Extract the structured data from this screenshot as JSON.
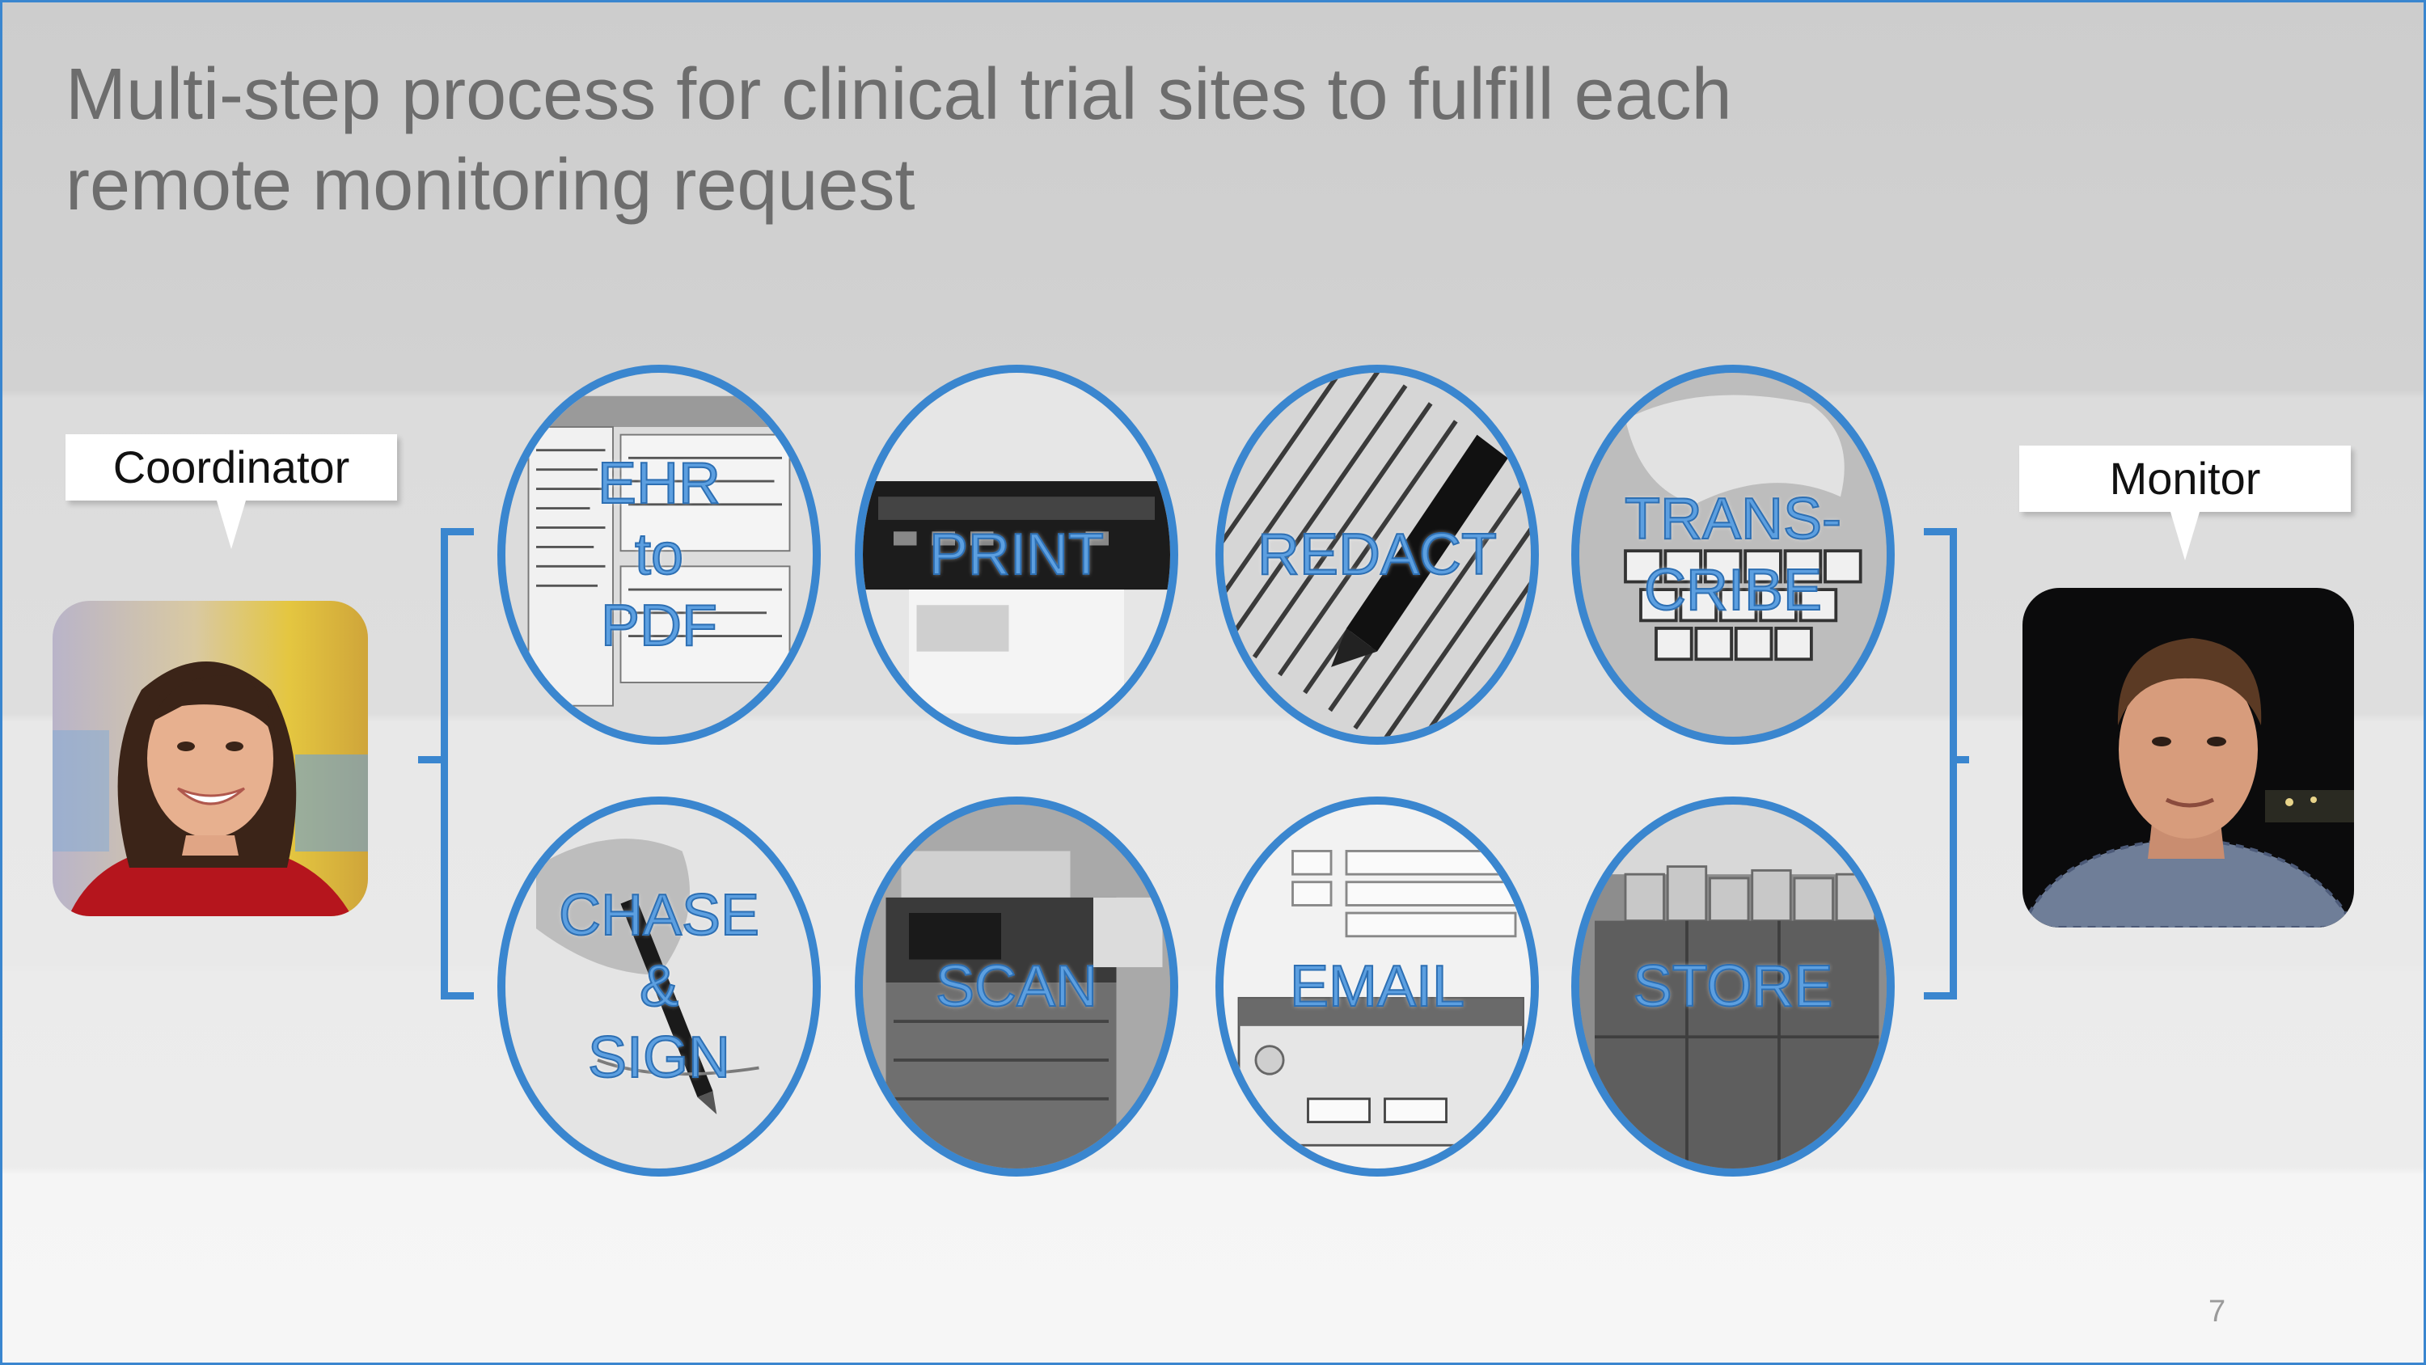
{
  "slide": {
    "title_line1": "Multi-step process for clinical trial sites to fulfill each",
    "title_line2": "remote monitoring request",
    "page_number": "7"
  },
  "roles": {
    "left": "Coordinator",
    "right": "Monitor"
  },
  "steps": [
    {
      "label": "EHR\nto\nPDF"
    },
    {
      "label": "PRINT"
    },
    {
      "label": "REDACT"
    },
    {
      "label": "TRANS-\nCRIBE"
    },
    {
      "label": "CHASE\n&\nSIGN"
    },
    {
      "label": "SCAN"
    },
    {
      "label": "EMAIL"
    },
    {
      "label": "STORE"
    }
  ],
  "colors": {
    "accent": "#3a86cf",
    "step_label": "#5c9fe0",
    "title": "#6d6d6d"
  }
}
